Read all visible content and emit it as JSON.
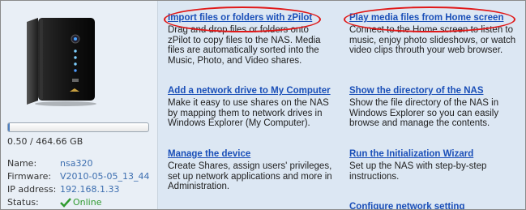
{
  "device": {
    "usage_text": "0.50 / 464.66 GB",
    "usage_fraction": 0.0011,
    "info": [
      {
        "label": "Name:",
        "value": "nsa320"
      },
      {
        "label": "Firmware:",
        "value": "V2010-05-05_13_44"
      },
      {
        "label": "IP address:",
        "value": "192.168.1.33"
      },
      {
        "label": "Status:",
        "value": "Online"
      }
    ],
    "status_icon": "check-icon",
    "status_color": "#2f9a2f"
  },
  "tasks": {
    "import": {
      "title": "Import files or folders with zPilot",
      "desc": "Drag and drop files or folders onto zPilot to copy files to the NAS. Media files are automatically sorted into the Music, Photo, and Video shares."
    },
    "network_drive": {
      "title": "Add a network drive to My Computer",
      "desc": "Make it easy to use shares on the NAS by mapping them to network drives in Windows Explorer (My Computer)."
    },
    "manage": {
      "title": "Manage the device",
      "desc": "Create Shares, assign users' privileges, set up network applications and more in Administration."
    },
    "play_media": {
      "title": "Play media files from Home screen",
      "desc": "Connect to the Home screen to listen to music, enjoy photo slideshows, or watch video clips throuth your web browser."
    },
    "directory": {
      "title": "Show the directory of the NAS",
      "desc": "Show the file directory of the NAS in Windows Explorer so you can easily browse and manage the contents."
    },
    "wizard": {
      "title": "Run the Initialization Wizard",
      "desc": "Set up the NAS with step-by-step instructions."
    },
    "network_setting": {
      "title": "Configure network setting"
    }
  },
  "colors": {
    "link": "#1a4fb8",
    "highlight_oval": "#e01818",
    "panel_bg": "#dce7f3"
  }
}
